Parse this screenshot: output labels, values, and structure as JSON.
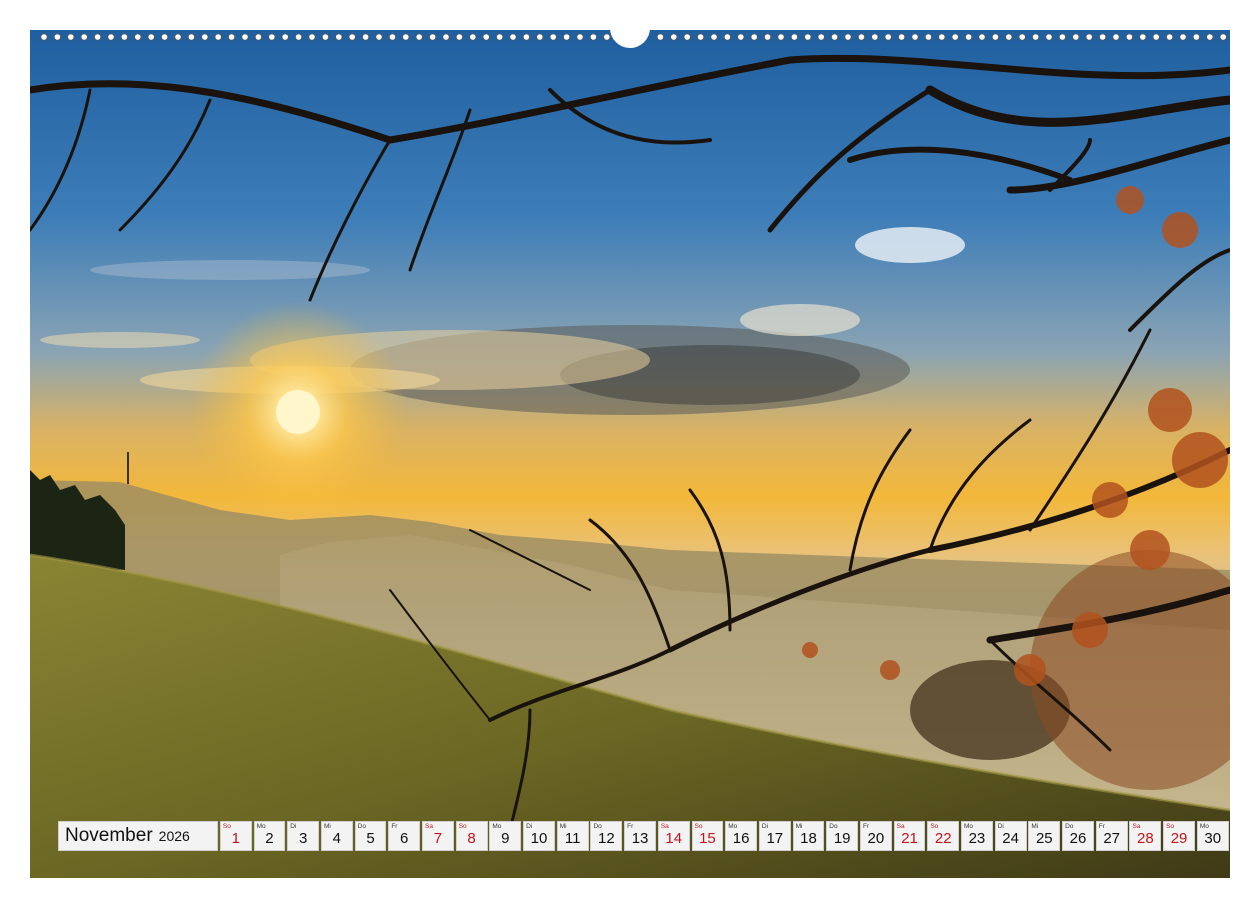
{
  "calendar": {
    "month": "November",
    "year": "2026",
    "days": [
      {
        "wd": "So",
        "d": "1",
        "we": true
      },
      {
        "wd": "Mo",
        "d": "2",
        "we": false
      },
      {
        "wd": "Di",
        "d": "3",
        "we": false
      },
      {
        "wd": "Mi",
        "d": "4",
        "we": false
      },
      {
        "wd": "Do",
        "d": "5",
        "we": false
      },
      {
        "wd": "Fr",
        "d": "6",
        "we": false
      },
      {
        "wd": "Sa",
        "d": "7",
        "we": true
      },
      {
        "wd": "So",
        "d": "8",
        "we": true
      },
      {
        "wd": "Mo",
        "d": "9",
        "we": false
      },
      {
        "wd": "Di",
        "d": "10",
        "we": false
      },
      {
        "wd": "Mi",
        "d": "11",
        "we": false
      },
      {
        "wd": "Do",
        "d": "12",
        "we": false
      },
      {
        "wd": "Fr",
        "d": "13",
        "we": false
      },
      {
        "wd": "Sa",
        "d": "14",
        "we": true
      },
      {
        "wd": "So",
        "d": "15",
        "we": true
      },
      {
        "wd": "Mo",
        "d": "16",
        "we": false
      },
      {
        "wd": "Di",
        "d": "17",
        "we": false
      },
      {
        "wd": "Mi",
        "d": "18",
        "we": false
      },
      {
        "wd": "Do",
        "d": "19",
        "we": false
      },
      {
        "wd": "Fr",
        "d": "20",
        "we": false
      },
      {
        "wd": "Sa",
        "d": "21",
        "we": true
      },
      {
        "wd": "So",
        "d": "22",
        "we": true
      },
      {
        "wd": "Mo",
        "d": "23",
        "we": false
      },
      {
        "wd": "Di",
        "d": "24",
        "we": false
      },
      {
        "wd": "Mi",
        "d": "25",
        "we": false
      },
      {
        "wd": "Do",
        "d": "26",
        "we": false
      },
      {
        "wd": "Fr",
        "d": "27",
        "we": false
      },
      {
        "wd": "Sa",
        "d": "28",
        "we": true
      },
      {
        "wd": "So",
        "d": "29",
        "we": true
      },
      {
        "wd": "Mo",
        "d": "30",
        "we": false
      }
    ]
  },
  "colors": {
    "weekend": "#c0161c",
    "sky_top": "#2f6fb0",
    "sun": "#ffd24a",
    "meadow": "#6e6a22"
  }
}
